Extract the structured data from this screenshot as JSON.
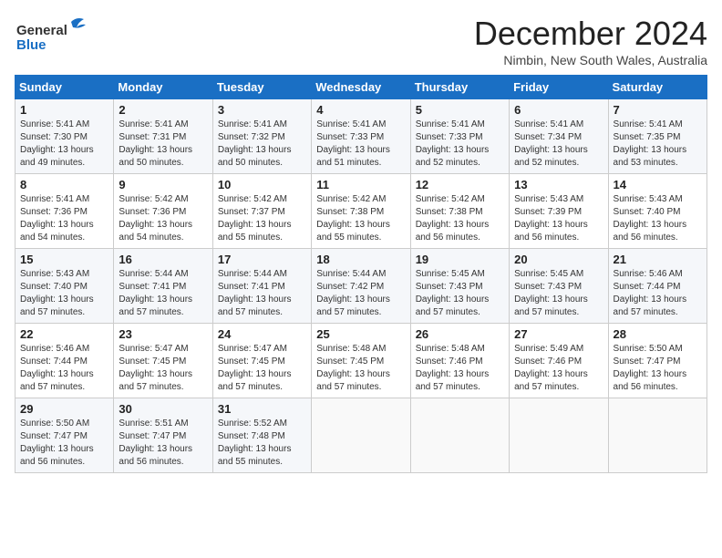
{
  "logo": {
    "general": "General",
    "blue": "Blue"
  },
  "title": "December 2024",
  "subtitle": "Nimbin, New South Wales, Australia",
  "weekdays": [
    "Sunday",
    "Monday",
    "Tuesday",
    "Wednesday",
    "Thursday",
    "Friday",
    "Saturday"
  ],
  "weeks": [
    [
      {
        "day": "1",
        "sunrise": "Sunrise: 5:41 AM",
        "sunset": "Sunset: 7:30 PM",
        "daylight": "Daylight: 13 hours and 49 minutes."
      },
      {
        "day": "2",
        "sunrise": "Sunrise: 5:41 AM",
        "sunset": "Sunset: 7:31 PM",
        "daylight": "Daylight: 13 hours and 50 minutes."
      },
      {
        "day": "3",
        "sunrise": "Sunrise: 5:41 AM",
        "sunset": "Sunset: 7:32 PM",
        "daylight": "Daylight: 13 hours and 50 minutes."
      },
      {
        "day": "4",
        "sunrise": "Sunrise: 5:41 AM",
        "sunset": "Sunset: 7:33 PM",
        "daylight": "Daylight: 13 hours and 51 minutes."
      },
      {
        "day": "5",
        "sunrise": "Sunrise: 5:41 AM",
        "sunset": "Sunset: 7:33 PM",
        "daylight": "Daylight: 13 hours and 52 minutes."
      },
      {
        "day": "6",
        "sunrise": "Sunrise: 5:41 AM",
        "sunset": "Sunset: 7:34 PM",
        "daylight": "Daylight: 13 hours and 52 minutes."
      },
      {
        "day": "7",
        "sunrise": "Sunrise: 5:41 AM",
        "sunset": "Sunset: 7:35 PM",
        "daylight": "Daylight: 13 hours and 53 minutes."
      }
    ],
    [
      {
        "day": "8",
        "sunrise": "Sunrise: 5:41 AM",
        "sunset": "Sunset: 7:36 PM",
        "daylight": "Daylight: 13 hours and 54 minutes."
      },
      {
        "day": "9",
        "sunrise": "Sunrise: 5:42 AM",
        "sunset": "Sunset: 7:36 PM",
        "daylight": "Daylight: 13 hours and 54 minutes."
      },
      {
        "day": "10",
        "sunrise": "Sunrise: 5:42 AM",
        "sunset": "Sunset: 7:37 PM",
        "daylight": "Daylight: 13 hours and 55 minutes."
      },
      {
        "day": "11",
        "sunrise": "Sunrise: 5:42 AM",
        "sunset": "Sunset: 7:38 PM",
        "daylight": "Daylight: 13 hours and 55 minutes."
      },
      {
        "day": "12",
        "sunrise": "Sunrise: 5:42 AM",
        "sunset": "Sunset: 7:38 PM",
        "daylight": "Daylight: 13 hours and 56 minutes."
      },
      {
        "day": "13",
        "sunrise": "Sunrise: 5:43 AM",
        "sunset": "Sunset: 7:39 PM",
        "daylight": "Daylight: 13 hours and 56 minutes."
      },
      {
        "day": "14",
        "sunrise": "Sunrise: 5:43 AM",
        "sunset": "Sunset: 7:40 PM",
        "daylight": "Daylight: 13 hours and 56 minutes."
      }
    ],
    [
      {
        "day": "15",
        "sunrise": "Sunrise: 5:43 AM",
        "sunset": "Sunset: 7:40 PM",
        "daylight": "Daylight: 13 hours and 57 minutes."
      },
      {
        "day": "16",
        "sunrise": "Sunrise: 5:44 AM",
        "sunset": "Sunset: 7:41 PM",
        "daylight": "Daylight: 13 hours and 57 minutes."
      },
      {
        "day": "17",
        "sunrise": "Sunrise: 5:44 AM",
        "sunset": "Sunset: 7:41 PM",
        "daylight": "Daylight: 13 hours and 57 minutes."
      },
      {
        "day": "18",
        "sunrise": "Sunrise: 5:44 AM",
        "sunset": "Sunset: 7:42 PM",
        "daylight": "Daylight: 13 hours and 57 minutes."
      },
      {
        "day": "19",
        "sunrise": "Sunrise: 5:45 AM",
        "sunset": "Sunset: 7:43 PM",
        "daylight": "Daylight: 13 hours and 57 minutes."
      },
      {
        "day": "20",
        "sunrise": "Sunrise: 5:45 AM",
        "sunset": "Sunset: 7:43 PM",
        "daylight": "Daylight: 13 hours and 57 minutes."
      },
      {
        "day": "21",
        "sunrise": "Sunrise: 5:46 AM",
        "sunset": "Sunset: 7:44 PM",
        "daylight": "Daylight: 13 hours and 57 minutes."
      }
    ],
    [
      {
        "day": "22",
        "sunrise": "Sunrise: 5:46 AM",
        "sunset": "Sunset: 7:44 PM",
        "daylight": "Daylight: 13 hours and 57 minutes."
      },
      {
        "day": "23",
        "sunrise": "Sunrise: 5:47 AM",
        "sunset": "Sunset: 7:45 PM",
        "daylight": "Daylight: 13 hours and 57 minutes."
      },
      {
        "day": "24",
        "sunrise": "Sunrise: 5:47 AM",
        "sunset": "Sunset: 7:45 PM",
        "daylight": "Daylight: 13 hours and 57 minutes."
      },
      {
        "day": "25",
        "sunrise": "Sunrise: 5:48 AM",
        "sunset": "Sunset: 7:45 PM",
        "daylight": "Daylight: 13 hours and 57 minutes."
      },
      {
        "day": "26",
        "sunrise": "Sunrise: 5:48 AM",
        "sunset": "Sunset: 7:46 PM",
        "daylight": "Daylight: 13 hours and 57 minutes."
      },
      {
        "day": "27",
        "sunrise": "Sunrise: 5:49 AM",
        "sunset": "Sunset: 7:46 PM",
        "daylight": "Daylight: 13 hours and 57 minutes."
      },
      {
        "day": "28",
        "sunrise": "Sunrise: 5:50 AM",
        "sunset": "Sunset: 7:47 PM",
        "daylight": "Daylight: 13 hours and 56 minutes."
      }
    ],
    [
      {
        "day": "29",
        "sunrise": "Sunrise: 5:50 AM",
        "sunset": "Sunset: 7:47 PM",
        "daylight": "Daylight: 13 hours and 56 minutes."
      },
      {
        "day": "30",
        "sunrise": "Sunrise: 5:51 AM",
        "sunset": "Sunset: 7:47 PM",
        "daylight": "Daylight: 13 hours and 56 minutes."
      },
      {
        "day": "31",
        "sunrise": "Sunrise: 5:52 AM",
        "sunset": "Sunset: 7:48 PM",
        "daylight": "Daylight: 13 hours and 55 minutes."
      },
      null,
      null,
      null,
      null
    ]
  ]
}
